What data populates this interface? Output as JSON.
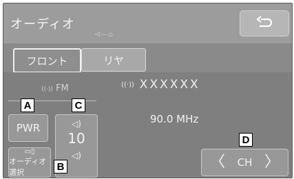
{
  "header": {
    "title": "オーディオ",
    "back_icon": "return-arrow-icon",
    "connection_icon": "⊲—⌂"
  },
  "tabs": [
    {
      "label": "フロント",
      "active": true
    },
    {
      "label": "リヤ",
      "active": false
    }
  ],
  "source": {
    "label": "FM",
    "icon": "((·))"
  },
  "station": {
    "name": "XXXXXX",
    "icon": "((·))"
  },
  "frequency": "90.0 MHz",
  "controls": {
    "power_label": "PWR",
    "volume_value": "10",
    "volume_icon": "◁)",
    "audio_select_label": "オーディオ選択",
    "audio_select_icon": "▭▯",
    "channel_label": "CH",
    "prev_icon": "〈",
    "next_icon": "〉"
  },
  "callouts": {
    "a": "A",
    "b": "B",
    "c": "C",
    "d": "D"
  },
  "colors": {
    "screen_bg": "#8a8a8a",
    "header_bg": "#9c9c9c",
    "text": "#f2f2f2"
  }
}
